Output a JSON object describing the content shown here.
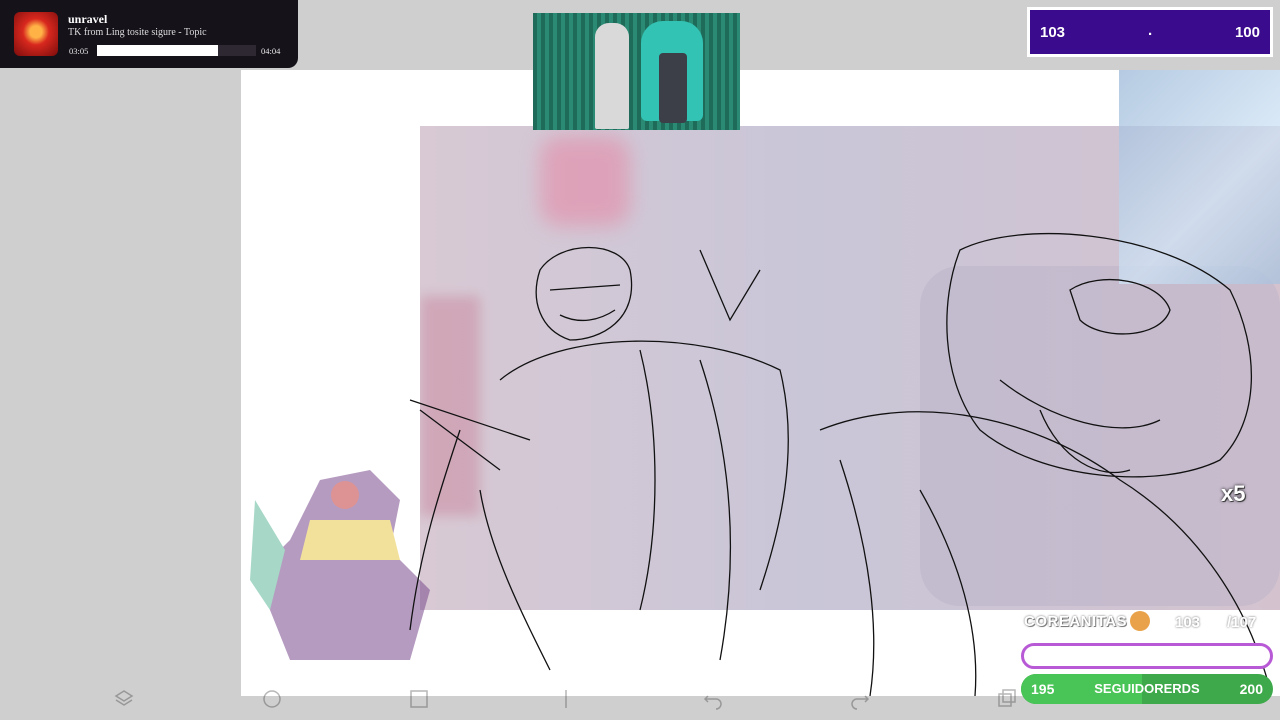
{
  "music_player": {
    "title": "unravel",
    "artist": "TK from Ling tosite sigure - Topic",
    "time_current": "03:05",
    "time_total": "04:04",
    "progress_fraction": 0.758
  },
  "score": {
    "left": "103",
    "separator": ".",
    "right": "100"
  },
  "combo": {
    "label": "x5"
  },
  "subscriber_goal": {
    "label": "COREANITAS",
    "current": "103",
    "goal": "/107"
  },
  "follower_goal": {
    "start": "195",
    "label": "SEGUIDORERDS",
    "end": "200",
    "progress_fraction": 0.48
  },
  "colors": {
    "score_bg": "#3a0b8c",
    "follower_bar": "#49c456",
    "subs_bar_border": "#b85ad6"
  },
  "toolbar_icons": [
    "layers-icon",
    "circle-icon",
    "square-icon",
    "pen-icon",
    "undo-icon",
    "redo-icon",
    "copy-icon"
  ]
}
